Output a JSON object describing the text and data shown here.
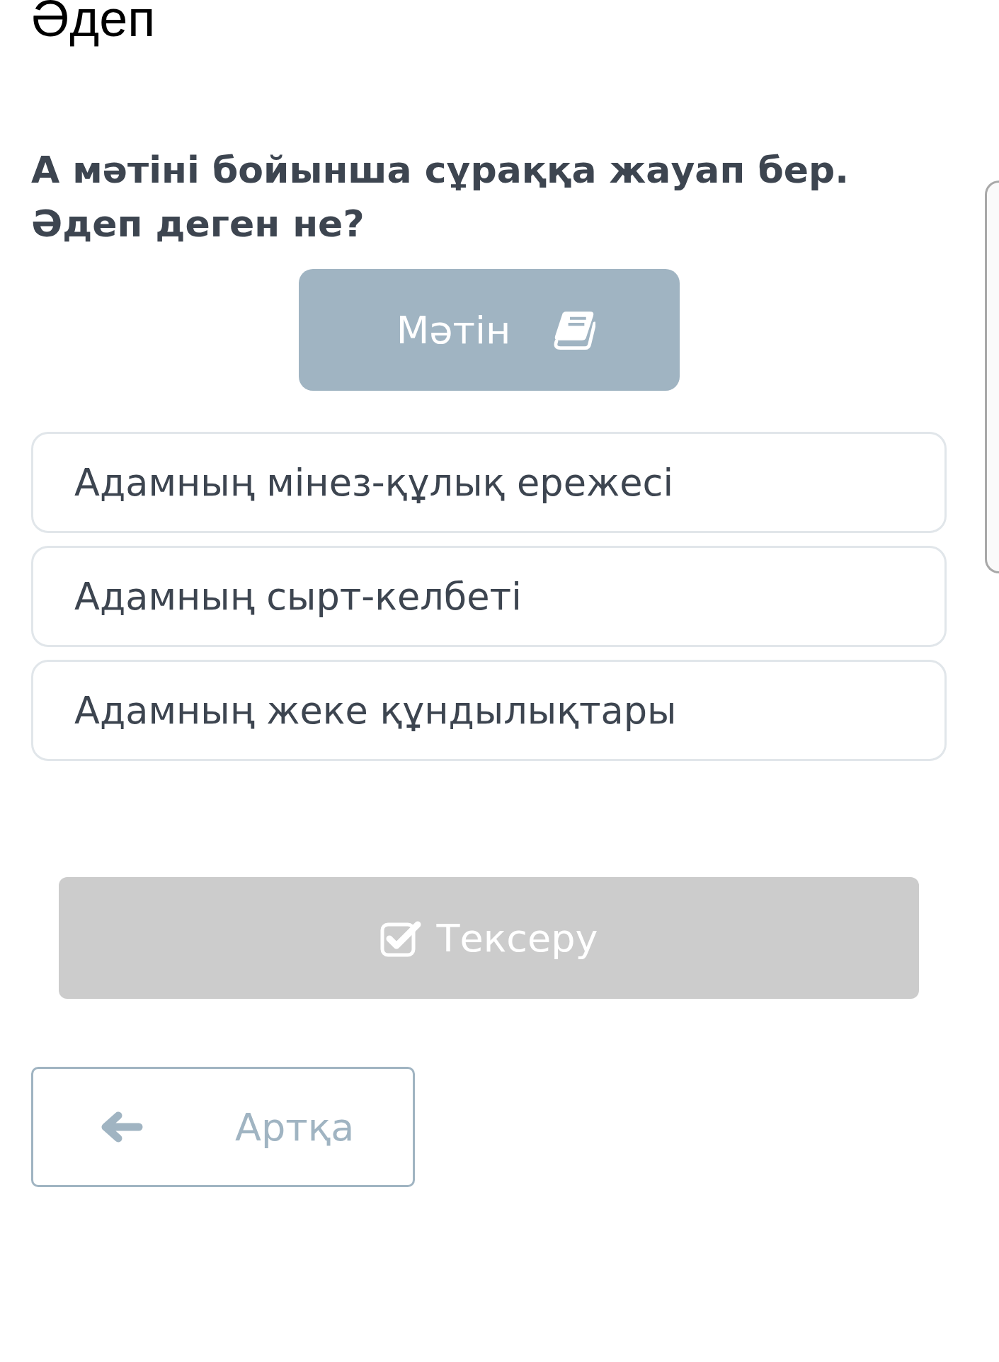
{
  "page_title": "Әдеп",
  "question": "А мәтіні бойынша сұраққа жауап бер.\nӘдеп деген не?",
  "text_button": {
    "label": "Мәтін"
  },
  "options": [
    {
      "label": "Адамның мінез-құлық ережесі",
      "selected": false
    },
    {
      "label": "Адамның сырт-келбеті",
      "selected": false
    },
    {
      "label": "Адамның жеке құндылықтары",
      "selected": false
    }
  ],
  "check_button": {
    "label": "Тексеру",
    "disabled": true
  },
  "back_button": {
    "label": "Артқа"
  }
}
